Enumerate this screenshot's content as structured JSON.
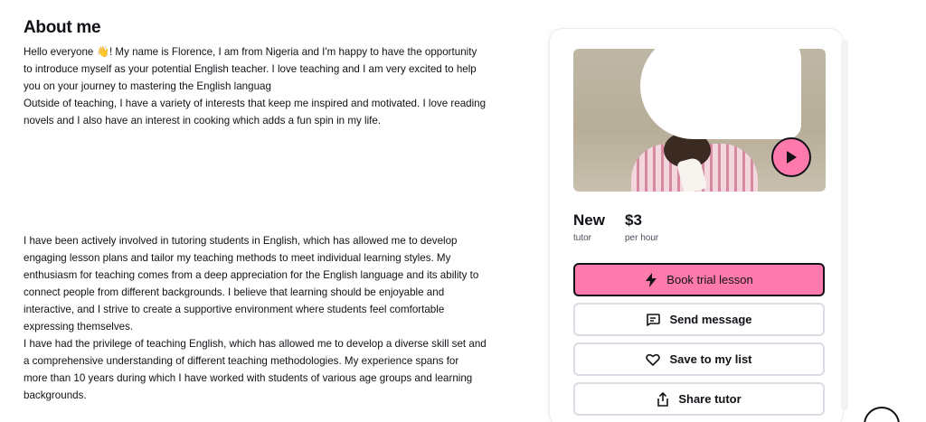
{
  "about": {
    "title": "About me",
    "intro_lines": [
      "Hello everyone 👋! My name is Florence, I am from Nigeria and I'm happy to have the opportunity",
      "to introduce myself as your potential English teacher. I love teaching and I am very excited to help",
      "you on your journey to mastering the English languag",
      "Outside of teaching, I have a variety of interests that keep me inspired and motivated. I love reading",
      "novels and I also have an interest in cooking which adds a fun spin in my life."
    ],
    "experience_lines": [
      "I have been actively involved in tutoring students in English, which has allowed me to develop",
      "engaging lesson plans and tailor my teaching methods to meet individual learning styles. My",
      "enthusiasm for teaching comes from a deep appreciation for the English language and its ability to",
      "connect people from different backgrounds. I believe that learning should be enjoyable and",
      "interactive, and I strive to create a supportive environment where students feel comfortable",
      "expressing themselves.",
      "I have had the privilege of teaching English, which has allowed me to develop a diverse skill set and",
      "a comprehensive understanding of different teaching methodologies. My experience spans for",
      "more than 10 years during which I have worked with students of various age groups and learning",
      "backgrounds."
    ]
  },
  "card": {
    "rating_value": "New",
    "rating_label": "tutor",
    "price_value": "$3",
    "price_label": "per hour",
    "book_label": "Book trial lesson",
    "message_label": "Send message",
    "save_label": "Save to my list",
    "share_label": "Share tutor",
    "icons": {
      "play": "play-icon",
      "book": "lightning-icon",
      "message": "message-icon",
      "save": "heart-icon",
      "share": "share-icon"
    }
  },
  "colors": {
    "accent": "#ff7aac",
    "text": "#121117",
    "border": "#dcdce5"
  }
}
